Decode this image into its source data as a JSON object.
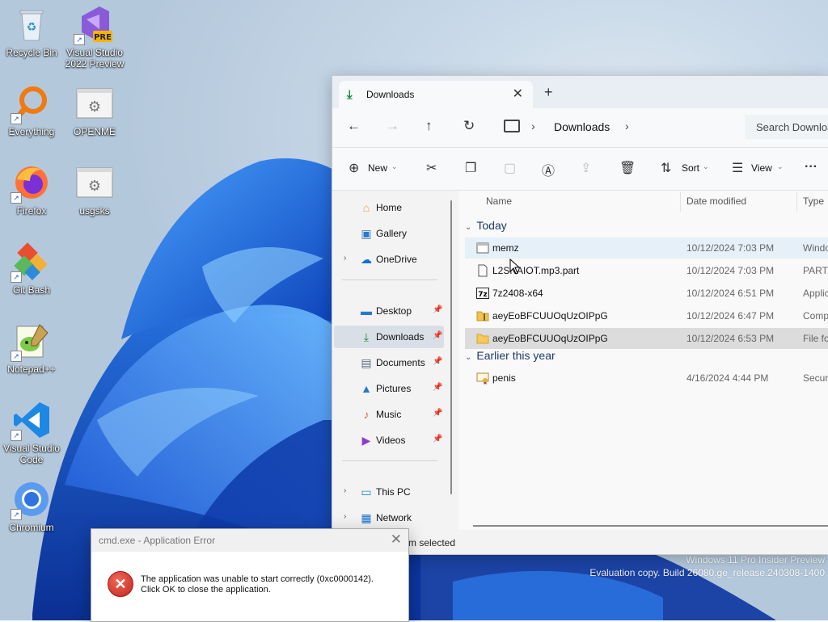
{
  "desktop": {
    "icons": [
      {
        "label": "Recycle Bin"
      },
      {
        "label": "Visual Studio 2022 Preview",
        "badge": "PRE"
      },
      {
        "label": "Everything"
      },
      {
        "label": "OPENME"
      },
      {
        "label": "Firefox"
      },
      {
        "label": "usgsks"
      },
      {
        "label": "Git Bash"
      },
      {
        "label": "Notepad++"
      },
      {
        "label": "Visual Studio Code"
      },
      {
        "label": "Chromium"
      }
    ],
    "watermark": {
      "line1": "Windows 11 Pro Insider Preview",
      "line2": "Evaluation copy. Build 26080.ge_release.240308-1400"
    }
  },
  "explorer": {
    "tab": {
      "title": "Downloads",
      "close": "✕",
      "new_tab": "+"
    },
    "nav": {
      "back": "←",
      "forward": "→",
      "up": "↑",
      "refresh": "↻"
    },
    "address": {
      "separator": "›",
      "crumb": "Downloads"
    },
    "search": {
      "placeholder": "Search Downloads"
    },
    "commands": {
      "new": "New",
      "sort": "Sort",
      "view": "View",
      "more": "···",
      "icons": {
        "new": "plus-icon",
        "cut": "scissors-icon",
        "copy": "copy-icon",
        "paste": "paste-icon",
        "rename": "rename-icon",
        "share": "share-icon",
        "delete": "trash-icon",
        "sort": "sort-icon",
        "view": "view-icon"
      }
    },
    "navpane": {
      "items": [
        {
          "label": "Home",
          "icon": "home-icon"
        },
        {
          "label": "Gallery",
          "icon": "gallery-icon"
        },
        {
          "label": "OneDrive",
          "icon": "cloud-icon"
        },
        {
          "label": "Desktop",
          "icon": "desktop-icon"
        },
        {
          "label": "Downloads",
          "icon": "download-icon"
        },
        {
          "label": "Documents",
          "icon": "document-icon"
        },
        {
          "label": "Pictures",
          "icon": "picture-icon"
        },
        {
          "label": "Music",
          "icon": "music-icon"
        },
        {
          "label": "Videos",
          "icon": "video-icon"
        },
        {
          "label": "This PC",
          "icon": "pc-icon"
        },
        {
          "label": "Network",
          "icon": "network-icon"
        }
      ]
    },
    "columns": {
      "name": "Name",
      "date": "Date modified",
      "type": "Type"
    },
    "groups": {
      "today": "Today",
      "earlier": "Earlier this year"
    },
    "files": [
      {
        "name": "memz",
        "date": "10/12/2024 7:03 PM",
        "type": "Windo",
        "icon": "app-window-icon"
      },
      {
        "name": "L2SNAIOT.mp3.part",
        "date": "10/12/2024 7:03 PM",
        "type": "PART F",
        "icon": "blank-file-icon"
      },
      {
        "name": "7z2408-x64",
        "date": "10/12/2024 6:51 PM",
        "type": "Applic",
        "icon": "7zip-icon"
      },
      {
        "name": "aeyEoBFCUUOqUzOIPpG",
        "date": "10/12/2024 6:47 PM",
        "type": "Comp",
        "icon": "zip-folder-icon"
      },
      {
        "name": "aeyEoBFCUUOqUzOIPpG",
        "date": "10/12/2024 6:53 PM",
        "type": "File fo",
        "icon": "folder-icon"
      },
      {
        "name": "penis",
        "date": "4/16/2024 4:44 PM",
        "type": "Securi",
        "icon": "certificate-icon"
      }
    ],
    "status": "m selected"
  },
  "dialog": {
    "title": "cmd.exe - Application Error",
    "close": "✕",
    "icon": "error-icon",
    "message_line1": "The application was unable to start correctly (0xc0000142).",
    "message_line2": "Click OK to close the application."
  },
  "colors": {
    "accent": "#0067c0",
    "wallpaper_blue": "#1f6fe0",
    "selection": "#dcdcdc"
  }
}
